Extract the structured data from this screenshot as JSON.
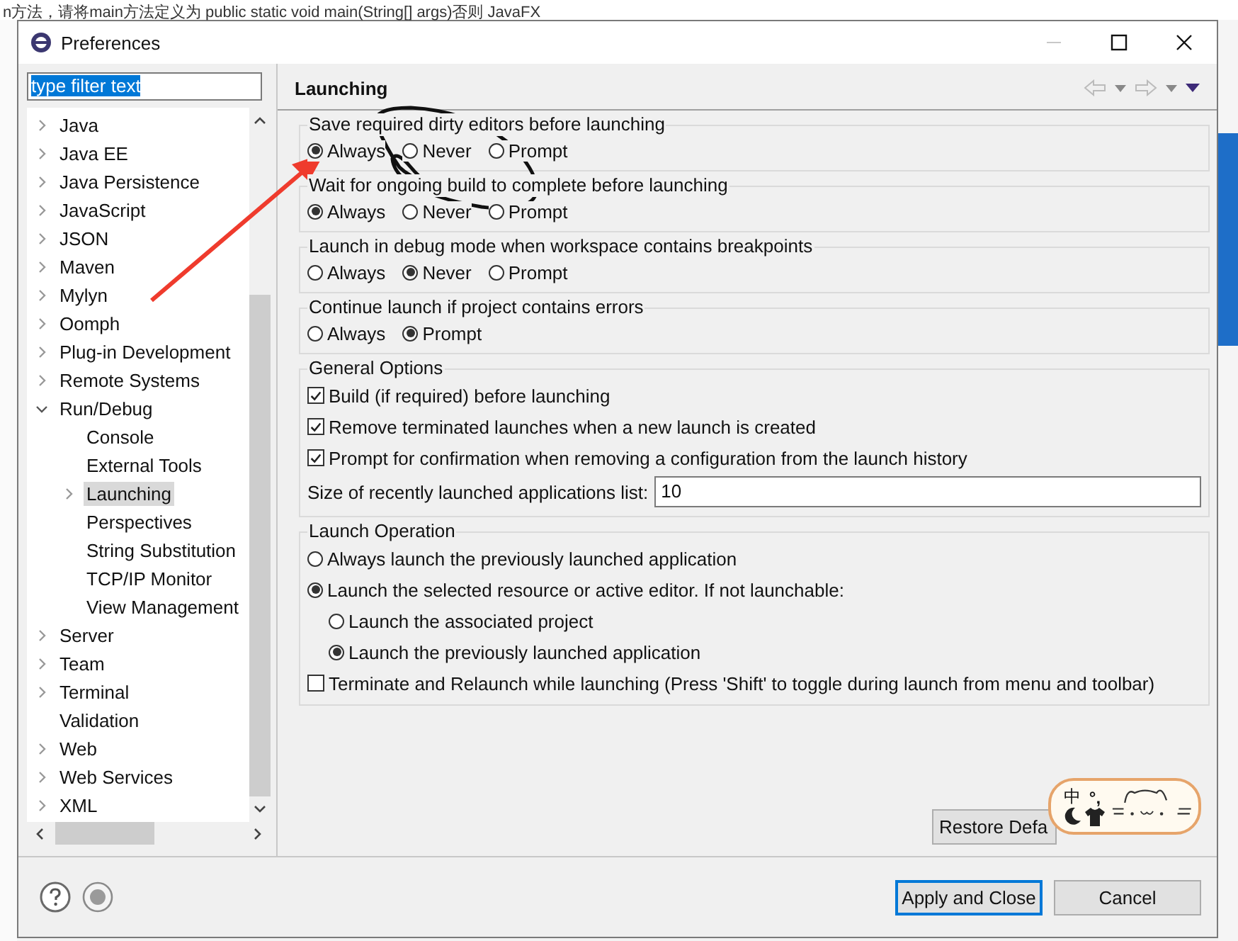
{
  "background": {
    "editor_text": "n方法，请将main方法定义为 public static void main(String[] args)否则 JavaFX"
  },
  "window": {
    "title": "Preferences"
  },
  "filter": {
    "value": "type filter text"
  },
  "tree": [
    {
      "label": "Java",
      "kind": "collapsed",
      "selected": false
    },
    {
      "label": "Java EE",
      "kind": "collapsed",
      "selected": false
    },
    {
      "label": "Java Persistence",
      "kind": "collapsed",
      "selected": false
    },
    {
      "label": "JavaScript",
      "kind": "collapsed",
      "selected": false
    },
    {
      "label": "JSON",
      "kind": "collapsed",
      "selected": false
    },
    {
      "label": "Maven",
      "kind": "collapsed",
      "selected": false
    },
    {
      "label": "Mylyn",
      "kind": "collapsed",
      "selected": false
    },
    {
      "label": "Oomph",
      "kind": "collapsed",
      "selected": false
    },
    {
      "label": "Plug-in Development",
      "kind": "collapsed",
      "selected": false
    },
    {
      "label": "Remote Systems",
      "kind": "collapsed",
      "selected": false
    },
    {
      "label": "Run/Debug",
      "kind": "expanded",
      "selected": false,
      "children": [
        {
          "label": "Console",
          "kind": "leaf",
          "selected": false
        },
        {
          "label": "External Tools",
          "kind": "leaf",
          "selected": false
        },
        {
          "label": "Launching",
          "kind": "collapsed",
          "selected": true
        },
        {
          "label": "Perspectives",
          "kind": "leaf",
          "selected": false
        },
        {
          "label": "String Substitution",
          "kind": "leaf",
          "selected": false
        },
        {
          "label": "TCP/IP Monitor",
          "kind": "leaf",
          "selected": false
        },
        {
          "label": "View Management",
          "kind": "leaf",
          "selected": false
        }
      ]
    },
    {
      "label": "Server",
      "kind": "collapsed",
      "selected": false
    },
    {
      "label": "Team",
      "kind": "collapsed",
      "selected": false
    },
    {
      "label": "Terminal",
      "kind": "collapsed",
      "selected": false
    },
    {
      "label": "Validation",
      "kind": "leaf",
      "selected": false
    },
    {
      "label": "Web",
      "kind": "collapsed",
      "selected": false
    },
    {
      "label": "Web Services",
      "kind": "collapsed",
      "selected": false
    },
    {
      "label": "XML",
      "kind": "collapsed",
      "selected": false
    }
  ],
  "page": {
    "title": "Launching",
    "groups": [
      {
        "title": "Save required dirty editors before launching",
        "kind": "radio",
        "options": [
          {
            "label": "Always",
            "selected": true
          },
          {
            "label": "Never",
            "selected": false
          },
          {
            "label": "Prompt",
            "selected": false
          }
        ]
      },
      {
        "title": "Wait for ongoing build to complete before launching",
        "kind": "radio",
        "options": [
          {
            "label": "Always",
            "selected": true
          },
          {
            "label": "Never",
            "selected": false
          },
          {
            "label": "Prompt",
            "selected": false
          }
        ]
      },
      {
        "title": "Launch in debug mode when workspace contains breakpoints",
        "kind": "radio",
        "options": [
          {
            "label": "Always",
            "selected": false
          },
          {
            "label": "Never",
            "selected": true
          },
          {
            "label": "Prompt",
            "selected": false
          }
        ]
      },
      {
        "title": "Continue launch if project contains errors",
        "kind": "radio",
        "options": [
          {
            "label": "Always",
            "selected": false
          },
          {
            "label": "Prompt",
            "selected": true
          }
        ]
      },
      {
        "title": "General Options",
        "kind": "list",
        "items": [
          {
            "kind": "checkbox",
            "label": "Build (if required) before launching",
            "checked": true
          },
          {
            "kind": "checkbox",
            "label": "Remove terminated launches when a new launch is created",
            "checked": true
          },
          {
            "kind": "checkbox",
            "label": "Prompt for confirmation when removing a configuration from the launch history",
            "checked": true
          },
          {
            "kind": "field",
            "label": "Size of recently launched applications list:",
            "value": "10"
          }
        ]
      },
      {
        "title": "Launch Operation",
        "kind": "list",
        "items": [
          {
            "kind": "radio",
            "label": "Always launch the previously launched application",
            "selected": false
          },
          {
            "kind": "radio",
            "label": "Launch the selected resource or active editor. If not launchable:",
            "selected": true,
            "children": [
              {
                "kind": "radio",
                "label": "Launch the associated project",
                "selected": false
              },
              {
                "kind": "radio",
                "label": "Launch the previously launched application",
                "selected": true
              }
            ]
          },
          {
            "kind": "checkbox",
            "label": "Terminate and Relaunch while launching (Press 'Shift' to toggle during launch from menu and toolbar)",
            "checked": false
          }
        ]
      }
    ],
    "buttons": [
      "Restore Defa"
    ]
  },
  "dialog_buttons": [
    {
      "label": "Apply and Close",
      "focused": true
    },
    {
      "label": "Cancel",
      "focused": false
    }
  ],
  "ime": {
    "mode": "中",
    "punct": "°,"
  }
}
